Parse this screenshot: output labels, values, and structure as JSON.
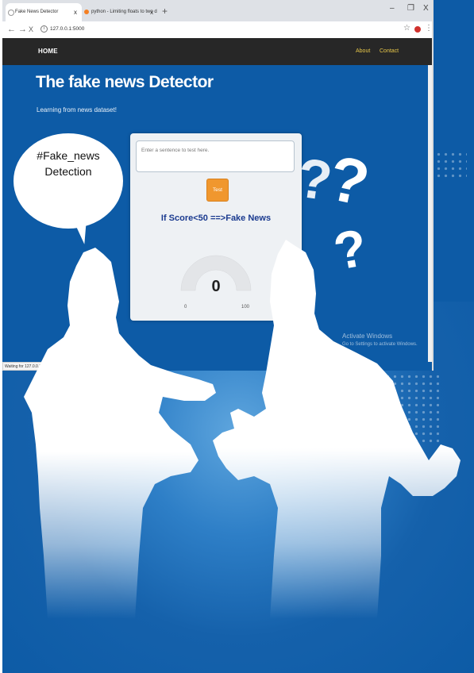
{
  "browser": {
    "tabs": [
      {
        "title": "Fake News Detector",
        "active": true
      },
      {
        "title": "python - Limiting floats to two d",
        "active": false
      }
    ],
    "new_tab": "+",
    "window_controls": {
      "minimize": "–",
      "restore": "❐",
      "close": "X"
    },
    "nav": {
      "back": "←",
      "forward": "→",
      "reload": "X"
    },
    "url": "127.0.0.1:5000",
    "status": "Waiting for 127.0.0.1..."
  },
  "navbar": {
    "home": "HOME",
    "about": "About",
    "contact": "Contact"
  },
  "page": {
    "title": "The fake news Detector",
    "subtitle": "Learning from news dataset!"
  },
  "card": {
    "input_placeholder": "Enter a sentence to test here.",
    "test_button": "Test",
    "score_rule": "If Score<50 ==>Fake News",
    "gauge": {
      "value": "0",
      "min": "0",
      "max": "100"
    }
  },
  "bubble": {
    "line1": "#Fake_news",
    "line2": "Detection"
  },
  "watermark": {
    "title": "Activate Windows",
    "subtitle": "Go to Settings to activate Windows."
  },
  "colors": {
    "background": "#0d5ba6",
    "navbar": "#272727",
    "accent_button": "#f0972e",
    "score_text": "#1a3a8f"
  }
}
